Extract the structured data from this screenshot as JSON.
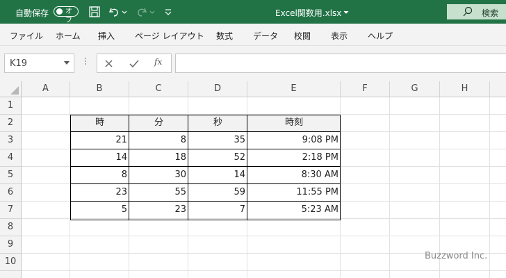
{
  "titlebar": {
    "autosave_label": "自動保存",
    "autosave_state": "オフ",
    "filename": "Excel関数用.xlsx",
    "search_label": "検索"
  },
  "ribbon": {
    "tabs": [
      "ファイル",
      "ホーム",
      "挿入",
      "ページ レイアウト",
      "数式",
      "データ",
      "校閲",
      "表示",
      "ヘルプ"
    ]
  },
  "formula_bar": {
    "name_box": "K19",
    "fx": "fx",
    "formula": ""
  },
  "sheet": {
    "columns": [
      "A",
      "B",
      "C",
      "D",
      "E",
      "F",
      "G",
      "H"
    ],
    "rows": [
      "1",
      "2",
      "3",
      "4",
      "5",
      "6",
      "7",
      "8",
      "9",
      "10"
    ],
    "table": {
      "headers": [
        "時",
        "分",
        "秒",
        "時刻"
      ],
      "rows": [
        [
          "21",
          "8",
          "35",
          "9:08 PM"
        ],
        [
          "14",
          "18",
          "52",
          "2:18 PM"
        ],
        [
          "8",
          "30",
          "14",
          "8:30 AM"
        ],
        [
          "23",
          "55",
          "59",
          "11:55 PM"
        ],
        [
          "5",
          "23",
          "7",
          "5:23 AM"
        ]
      ]
    }
  },
  "watermark": "Buzzword Inc.",
  "colors": {
    "titlebar": "#217346",
    "search_box": "#c7e0cd",
    "ribbon": "#f3f3f3"
  }
}
